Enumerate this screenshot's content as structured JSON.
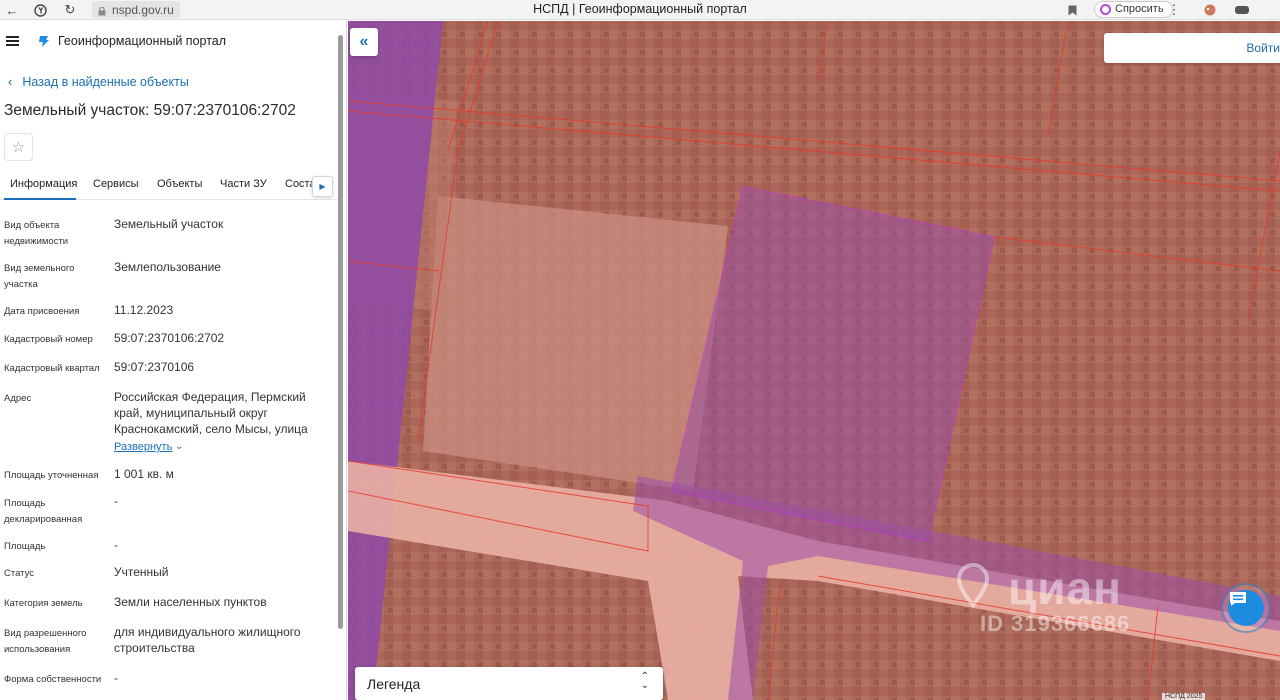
{
  "browser": {
    "url": "nspd.gov.ru",
    "tab_title": "НСПД | Геоинформационный портал",
    "ask_label": "Спросить"
  },
  "header": {
    "portal_name": "Геоинформационный портал"
  },
  "back_link": "Назад в найденные объекты",
  "object_title": "Земельный участок: 59:07:2370106:2702",
  "tabs": [
    {
      "label": "Информация"
    },
    {
      "label": "Сервисы"
    },
    {
      "label": "Объекты"
    },
    {
      "label": "Части ЗУ"
    },
    {
      "label": "Соста"
    }
  ],
  "info_rows": [
    {
      "label": "Вид объекта недвижимости",
      "value": "Земельный участок"
    },
    {
      "label": "Вид земельного участка",
      "value": "Землепользование"
    },
    {
      "label": "Дата присвоения",
      "value": "11.12.2023"
    },
    {
      "label": "Кадастровый номер",
      "value": "59:07:2370106:2702"
    },
    {
      "label": "Кадастровый квартал",
      "value": "59:07:2370106"
    },
    {
      "label": "Адрес",
      "value": "Российская Федерация, Пермский край, муниципальный округ Краснокамский, село Мысы, улица"
    },
    {
      "label": "Площадь уточненная",
      "value": "1 001 кв. м"
    },
    {
      "label": "Площадь декларированная",
      "value": "-"
    },
    {
      "label": "Площадь",
      "value": "-"
    },
    {
      "label": "Статус",
      "value": "Учтенный"
    },
    {
      "label": "Категория земель",
      "value": "Земли населенных пунктов"
    },
    {
      "label": "Вид разрешенного использования",
      "value": "для индивидуального жилищного строительства"
    },
    {
      "label": "Форма собственности",
      "value": "-"
    }
  ],
  "expand_label": "Развернуть",
  "map": {
    "login_label": "Войти",
    "legend_label": "Легенда",
    "watermark_brand": "циан",
    "watermark_id": "ID 319366686",
    "scale_text": "НСПД 2025",
    "colors": {
      "satellite": "#ae6a5c",
      "parcel_outline": "#b53bc9",
      "boundary_lines": "#e83a2a",
      "accent": "#1c6fb5"
    }
  }
}
